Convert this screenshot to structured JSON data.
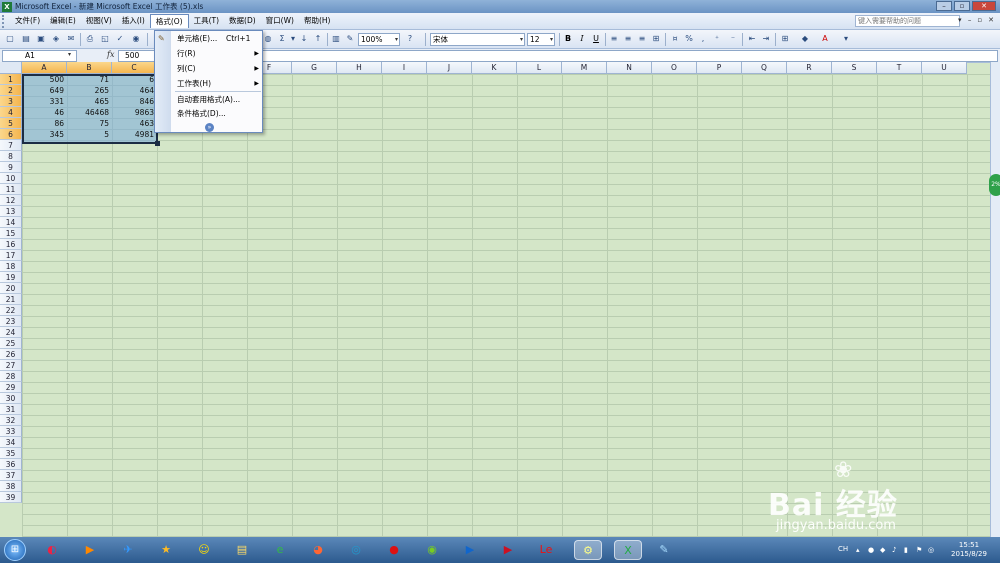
{
  "window": {
    "title": "Microsoft Excel - 新建 Microsoft Excel 工作表 (5).xls"
  },
  "menubar": {
    "items": [
      "文件(F)",
      "编辑(E)",
      "视图(V)",
      "插入(I)",
      "格式(O)",
      "工具(T)",
      "数据(D)",
      "窗口(W)",
      "帮助(H)"
    ],
    "active": "格式(O)",
    "help_placeholder": "键入需要帮助的问题"
  },
  "toolbar": {
    "zoom": "100%",
    "font_name": "宋体",
    "font_size": "12",
    "bold": "B",
    "italic": "I",
    "underline": "U",
    "percent": "%"
  },
  "formula_bar": {
    "name_box": "A1",
    "fx": "fx",
    "value": "500"
  },
  "format_menu": {
    "items": [
      {
        "label": "单元格(E)...",
        "shortcut": "Ctrl+1",
        "submenu": false
      },
      {
        "label": "行(R)",
        "shortcut": "",
        "submenu": true
      },
      {
        "label": "列(C)",
        "shortcut": "",
        "submenu": true
      },
      {
        "label": "工作表(H)",
        "shortcut": "",
        "submenu": true
      },
      {
        "label": "自动套用格式(A)...",
        "shortcut": "",
        "submenu": false
      },
      {
        "label": "条件格式(D)...",
        "shortcut": "",
        "submenu": false
      }
    ],
    "expand_icon": "double-chevron-down-icon"
  },
  "sheet": {
    "columns": [
      "A",
      "B",
      "C",
      "D",
      "E",
      "F",
      "G",
      "H",
      "I",
      "J",
      "K",
      "L",
      "M",
      "N",
      "O",
      "P",
      "Q",
      "R",
      "S",
      "T",
      "U"
    ],
    "selected_columns": [
      "A",
      "B",
      "C"
    ],
    "row_count": 39,
    "selected_rows": [
      1,
      2,
      3,
      4,
      5,
      6
    ],
    "data": [
      [
        "500",
        "71",
        "6"
      ],
      [
        "649",
        "265",
        "464"
      ],
      [
        "331",
        "465",
        "846"
      ],
      [
        "46",
        "46468",
        "9863"
      ],
      [
        "86",
        "75",
        "463"
      ],
      [
        "345",
        "5",
        "4981"
      ]
    ]
  },
  "watermark": {
    "brand": "Bai 经验",
    "url": "jingyan.baidu.com"
  },
  "side_bubble": "2%",
  "taskbar": {
    "ime": "CH",
    "time": "15:51",
    "date": "2015/8/29",
    "apps": [
      "360-browser-icon",
      "media-icon",
      "bird-icon",
      "star-icon",
      "qq-icon",
      "folder-icon",
      "ie-icon",
      "chrome-icon",
      "sync-icon",
      "record-icon",
      "green-player-icon",
      "player-icon",
      "red-player-icon",
      "le-icon",
      "tool-icon",
      "excel-icon",
      "paint-icon"
    ]
  }
}
